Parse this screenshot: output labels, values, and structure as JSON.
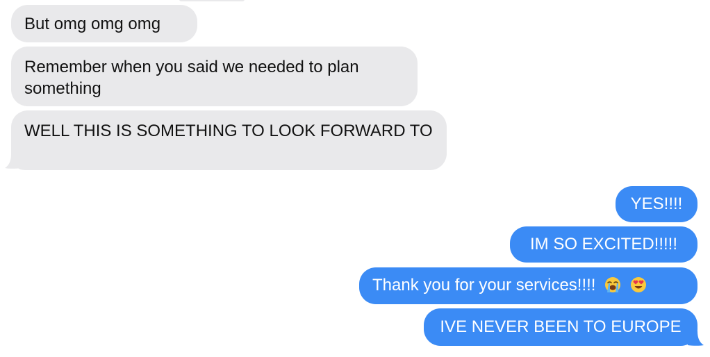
{
  "colors": {
    "incoming_bubble": "#e9e9eb",
    "incoming_text": "#111111",
    "outgoing_bubble": "#3b8bf5",
    "outgoing_text": "#ffffff"
  },
  "messages": {
    "incoming": [
      {
        "text": "But omg omg omg"
      },
      {
        "text": "Remember when you said we needed to plan something"
      },
      {
        "text": "WELL THIS IS SOMETHING TO LOOK FORWARD TO"
      }
    ],
    "outgoing": [
      {
        "text": "YES!!!!"
      },
      {
        "text": "IM SO EXCITED!!!!!"
      },
      {
        "text": "Thank you for your services!!!!",
        "emojis": [
          "loudly-crying-face-icon",
          "heart-eyes-face-icon"
        ]
      },
      {
        "text": "IVE NEVER BEEN TO EUROPE"
      }
    ]
  }
}
